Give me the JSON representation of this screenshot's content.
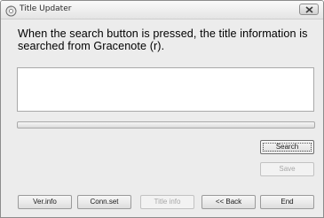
{
  "window": {
    "title": "Title Updater",
    "app_icon": "disc-icon",
    "close_icon": "close-icon"
  },
  "main": {
    "message": "When the search button is pressed, the title information is searched from Gracenote (r).",
    "result_text": ""
  },
  "buttons": {
    "search": "Search",
    "save": "Save",
    "ver_info": "Ver.info",
    "conn_set": "Conn.set",
    "title_info": "Title info",
    "back": "<< Back",
    "end": "End"
  }
}
